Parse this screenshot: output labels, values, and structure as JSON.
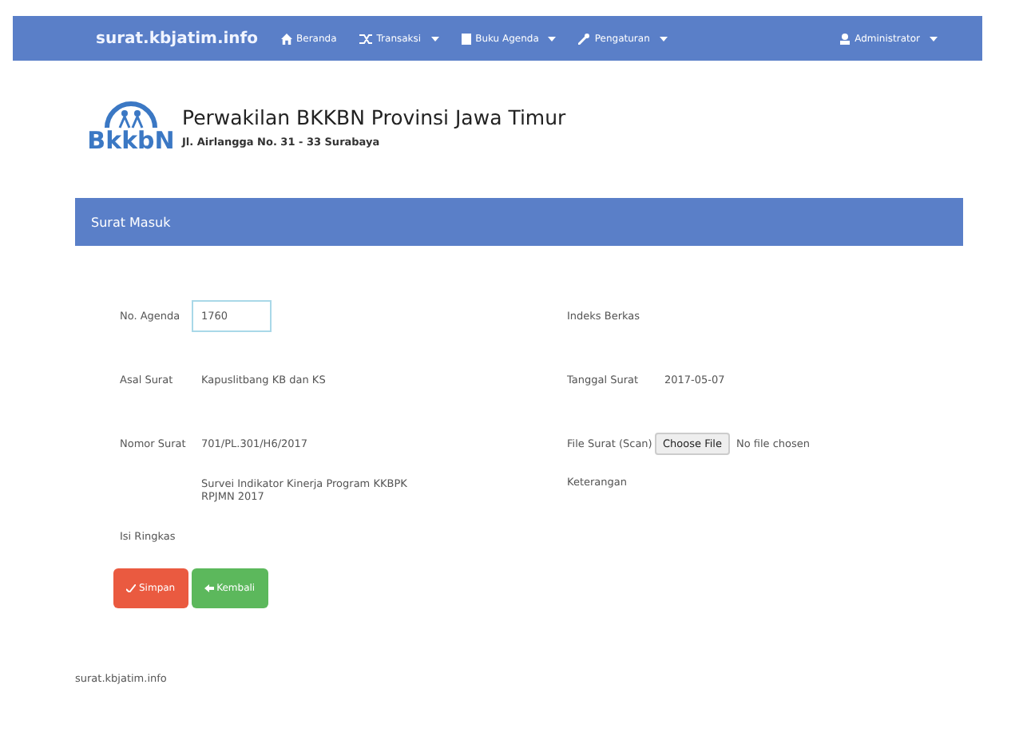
{
  "navbar": {
    "brand": "surat.kbjatim.info",
    "items": [
      {
        "label": "Beranda",
        "dropdown": false
      },
      {
        "label": "Transaksi",
        "dropdown": true
      },
      {
        "label": "Buku Agenda",
        "dropdown": true
      },
      {
        "label": "Pengaturan",
        "dropdown": true
      }
    ],
    "user": {
      "label": "Administrator",
      "dropdown": true
    }
  },
  "header": {
    "logo_text": "BkkbN",
    "title": "Perwakilan BKKBN Provinsi Jawa Timur",
    "address": "Jl. Airlangga No. 31 - 33 Surabaya"
  },
  "panel": {
    "title": "Surat Masuk",
    "left_fields": [
      {
        "label": "No. Agenda",
        "value": "1760",
        "kind": "input",
        "focused": true
      },
      {
        "label": "Asal Surat",
        "value": "Kapuslitbang KB dan KS",
        "kind": "input",
        "focused": false
      },
      {
        "label": "Nomor Surat",
        "value": "701/PL.301/H6/2017",
        "kind": "input",
        "focused": false
      },
      {
        "label": "Isi Ringkas",
        "value": "Survei Indikator Kinerja Program KKBPK RPJMN 2017",
        "kind": "textarea",
        "focused": false
      }
    ],
    "right_fields": [
      {
        "label": "Indeks Berkas",
        "kind": "input",
        "focused": false
      },
      {
        "label": "Tanggal Surat",
        "value": "2017-05-07",
        "kind": "input",
        "focused": false
      },
      {
        "label": "File Surat (Scan)",
        "button": "Choose File",
        "status": "No file chosen",
        "kind": "file"
      },
      {
        "label": "Keterangan",
        "kind": "textarea",
        "focused": false
      }
    ],
    "buttons": [
      {
        "label": "Simpan",
        "kind": "save"
      },
      {
        "label": "Kembali",
        "kind": "back"
      }
    ]
  },
  "footer": "surat.kbjatim.info"
}
